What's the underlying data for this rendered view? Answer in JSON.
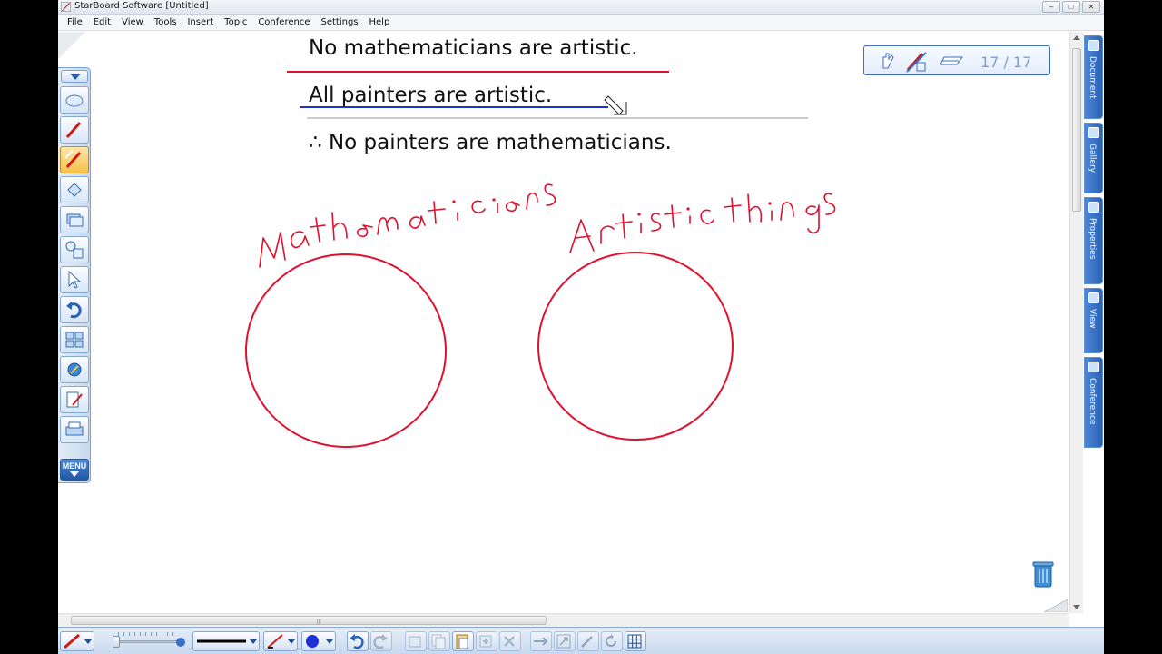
{
  "window": {
    "title": "StarBoard Software [Untitled]",
    "controls": [
      "minimize",
      "maximize",
      "close"
    ]
  },
  "menubar": {
    "items": [
      "File",
      "Edit",
      "View",
      "Tools",
      "Insert",
      "Topic",
      "Conference",
      "Settings",
      "Help"
    ]
  },
  "slide": {
    "premise1": "No mathematicians are artistic.",
    "premise2": "All painters are artistic.",
    "conclusion": "∴ No painters are mathematicians.",
    "handwritten_left": "Mathematicians",
    "handwritten_right": "Artistic things",
    "ink_colors": {
      "red": "#e0102e",
      "blue": "#1d2fd6"
    }
  },
  "page_navigator": {
    "page_label": "17 / 17",
    "icons": [
      "hand-icon",
      "no-pen-icon",
      "layers-icon"
    ]
  },
  "left_toolbar": {
    "tools": [
      "collapse-arrow-icon",
      "eraser-icon",
      "pen-icon",
      "highlighter-icon",
      "paint-bucket-icon",
      "stack-icon",
      "shapes-icon",
      "select-arrow-icon",
      "undo-icon",
      "layout-icon",
      "tools-icon",
      "edit-icon",
      "print-icon"
    ],
    "menu_label": "MENU"
  },
  "side_tabs": {
    "items": [
      "Document",
      "Gallery",
      "Properties",
      "View",
      "Conference"
    ]
  },
  "bottom_toolbar": {
    "tools": [
      "line-style",
      "width-slider",
      "pen-color",
      "fill-color",
      "undo",
      "redo",
      "cut",
      "copy",
      "paste",
      "add",
      "delete",
      "move",
      "resize",
      "edit",
      "rotate",
      "grid"
    ],
    "accent": "#2a62b6"
  }
}
